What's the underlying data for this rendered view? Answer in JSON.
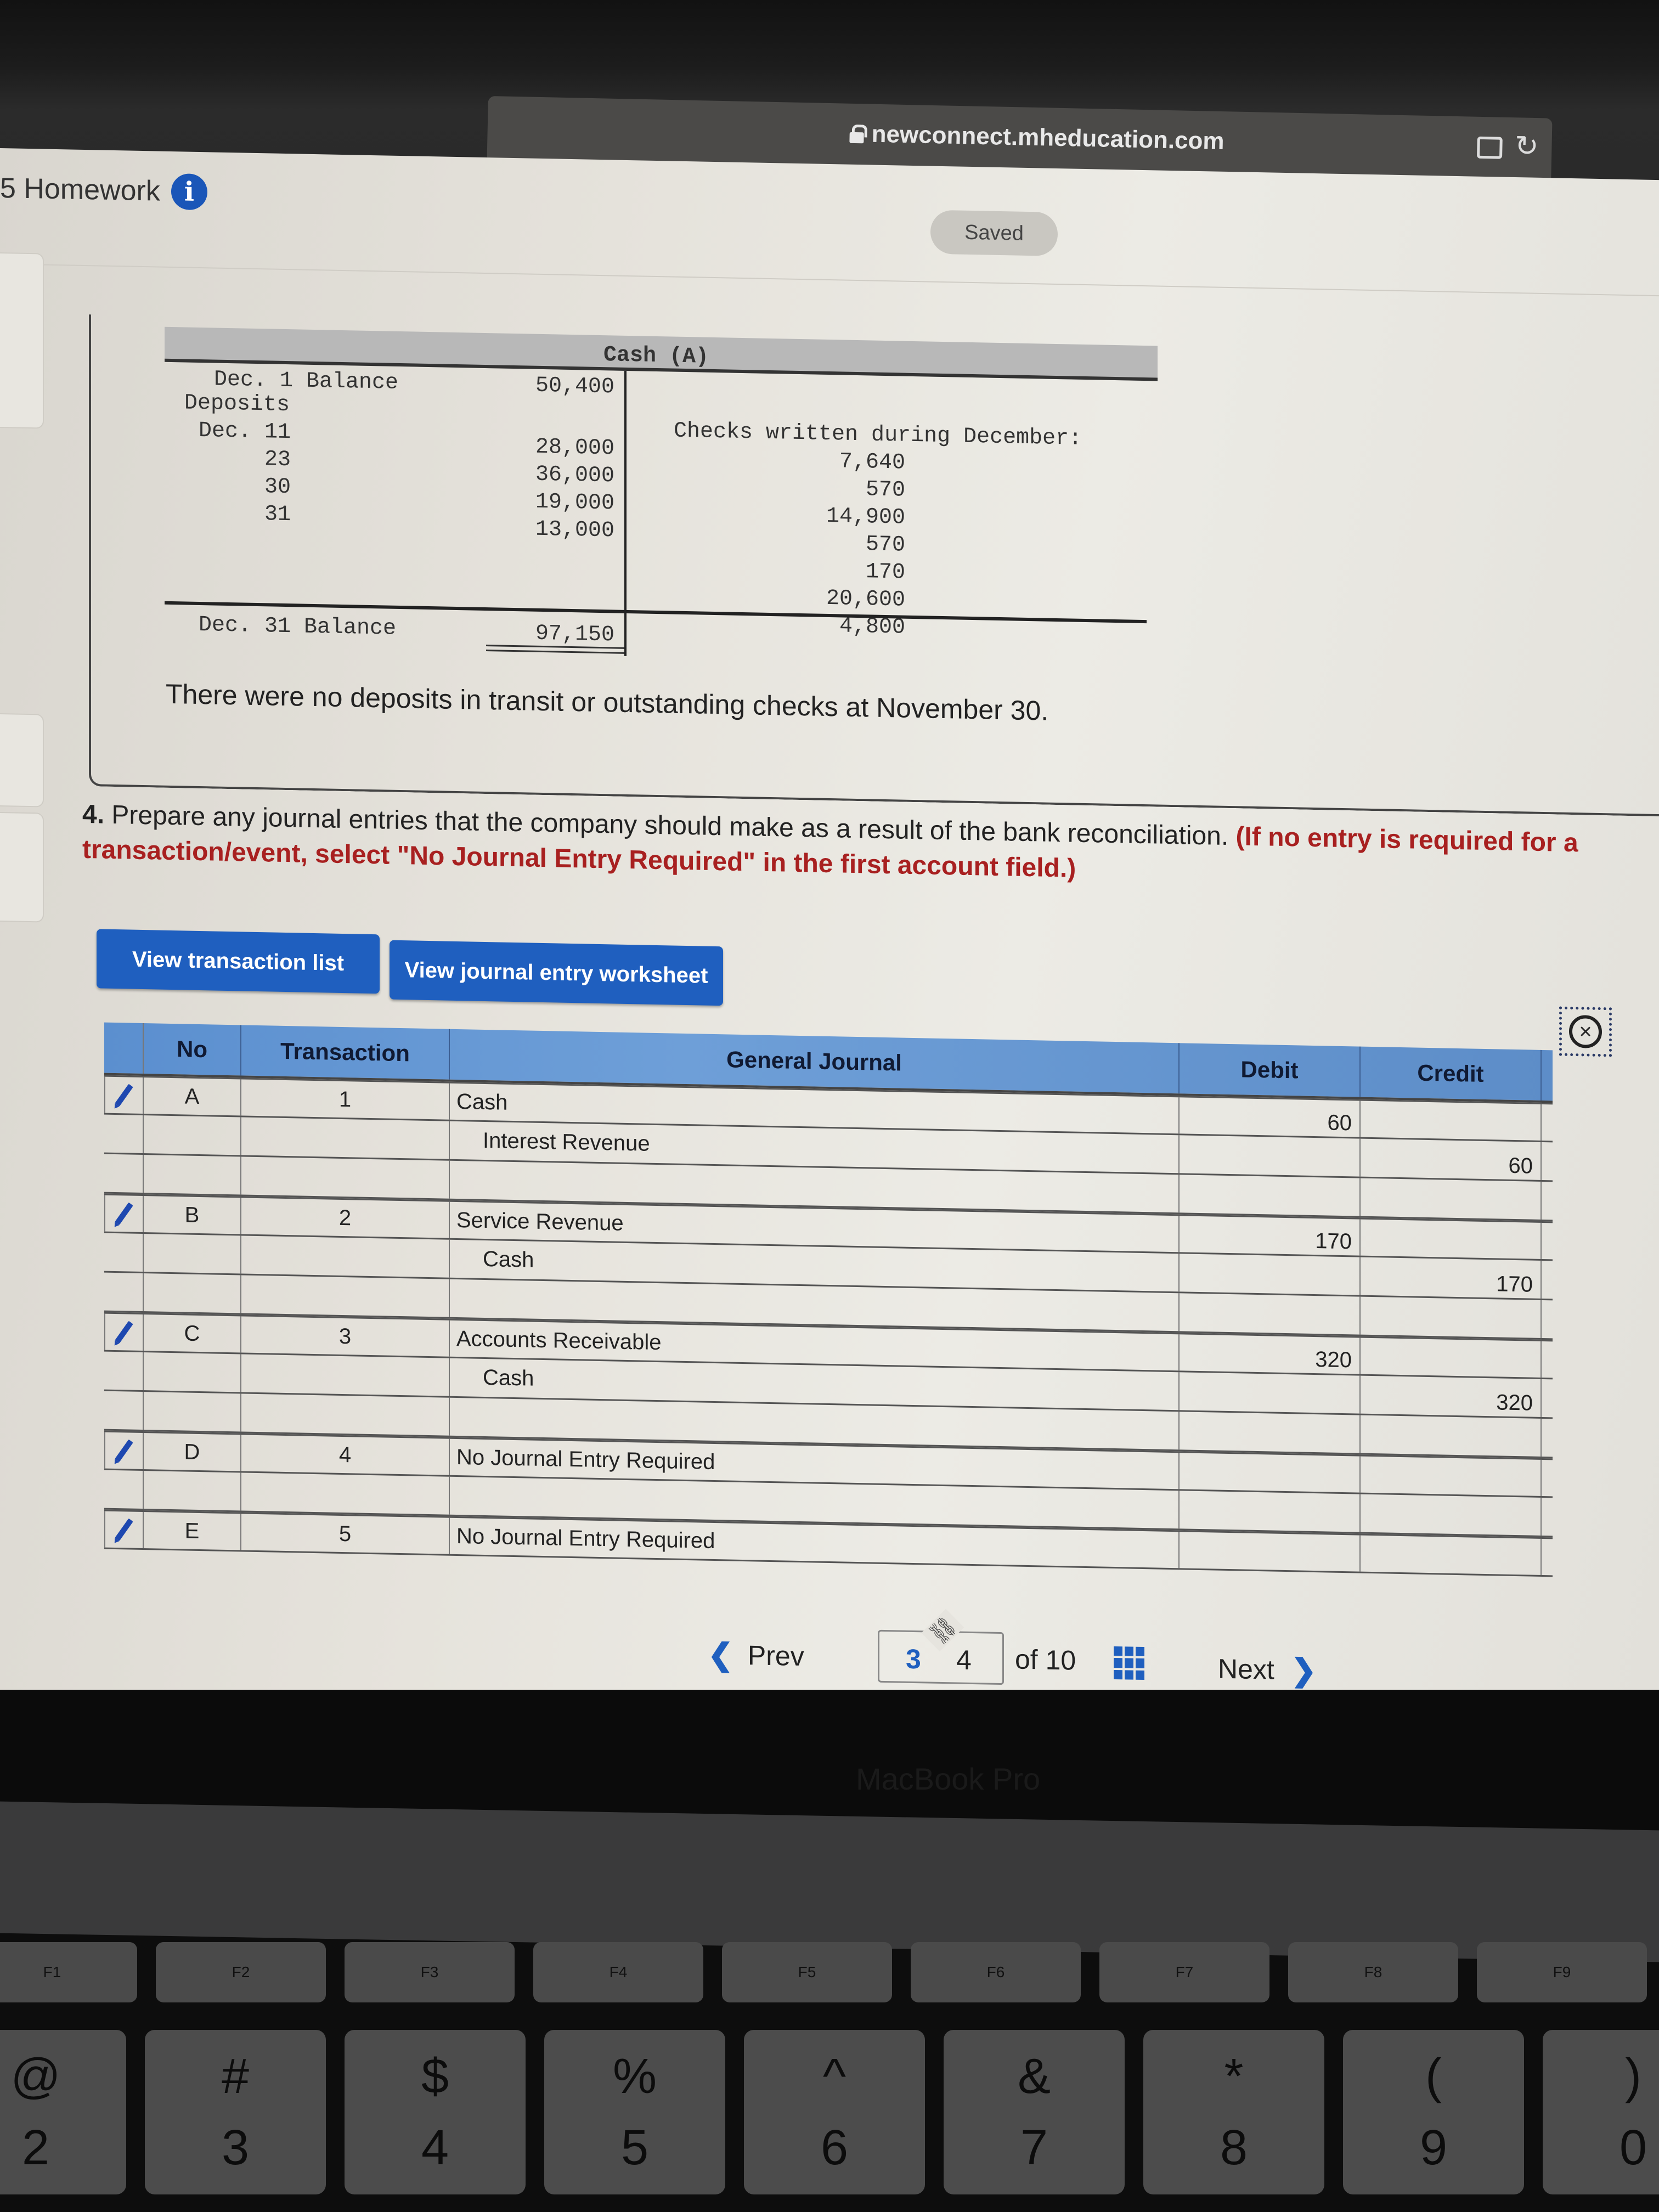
{
  "browser": {
    "url": "newconnect.mheducation.com",
    "tabs_icon": "tabs-icon",
    "reload_icon": "reload-icon"
  },
  "header": {
    "title": "5 Homework",
    "info_icon": "i",
    "status": "Saved"
  },
  "t_account": {
    "title": "Cash (A)",
    "left": [
      {
        "label": "Dec. 1 Balance",
        "amount": "50,400"
      },
      {
        "label": "Deposits",
        "amount": ""
      },
      {
        "label": "Dec. 11",
        "amount": "28,000"
      },
      {
        "label": "     23",
        "amount": "36,000"
      },
      {
        "label": "     30",
        "amount": "19,000"
      },
      {
        "label": "     31",
        "amount": "13,000"
      }
    ],
    "right_title": "Checks written during December:",
    "right": [
      "7,640",
      "570",
      "14,900",
      "570",
      "170",
      "20,600",
      "4,800"
    ],
    "ending_label": "Dec. 31 Balance",
    "ending_amount": "97,150"
  },
  "note": "There were no deposits in transit or outstanding checks at November 30.",
  "question": {
    "number": "4.",
    "text": "Prepare any journal entries that the company should make as a result of the bank reconciliation.",
    "instruction": "(If no entry is required for a transaction/event, select \"No Journal Entry Required\" in the first account field.)"
  },
  "buttons": {
    "view_transactions": "View transaction list",
    "view_worksheet": "View journal entry worksheet"
  },
  "journal": {
    "headers": {
      "no": "No",
      "transaction": "Transaction",
      "account": "General Journal",
      "debit": "Debit",
      "credit": "Credit"
    },
    "entries": [
      {
        "no": "A",
        "transaction": "1",
        "lines": [
          {
            "account": "Cash",
            "debit": "60",
            "credit": "",
            "indent": false
          },
          {
            "account": "Interest Revenue",
            "debit": "",
            "credit": "60",
            "indent": true
          },
          {
            "account": "",
            "debit": "",
            "credit": "",
            "indent": false
          }
        ]
      },
      {
        "no": "B",
        "transaction": "2",
        "lines": [
          {
            "account": "Service Revenue",
            "debit": "170",
            "credit": "",
            "indent": false
          },
          {
            "account": "Cash",
            "debit": "",
            "credit": "170",
            "indent": true
          },
          {
            "account": "",
            "debit": "",
            "credit": "",
            "indent": false
          }
        ]
      },
      {
        "no": "C",
        "transaction": "3",
        "lines": [
          {
            "account": "Accounts Receivable",
            "debit": "320",
            "credit": "",
            "indent": false
          },
          {
            "account": "Cash",
            "debit": "",
            "credit": "320",
            "indent": true
          },
          {
            "account": "",
            "debit": "",
            "credit": "",
            "indent": false
          }
        ]
      },
      {
        "no": "D",
        "transaction": "4",
        "lines": [
          {
            "account": "No Journal Entry Required",
            "debit": "",
            "credit": "",
            "indent": false
          },
          {
            "account": "",
            "debit": "",
            "credit": "",
            "indent": false
          }
        ]
      },
      {
        "no": "E",
        "transaction": "5",
        "lines": [
          {
            "account": "No Journal Entry Required",
            "debit": "",
            "credit": "",
            "indent": false
          }
        ]
      }
    ]
  },
  "pagination": {
    "prev_label": "Prev",
    "current_page": "3",
    "next_page": "4",
    "of_total": "of 10",
    "next_label": "Next"
  },
  "device": {
    "brand": "MacBook Pro",
    "fkeys": [
      "F1",
      "F2",
      "F3",
      "F4",
      "F5",
      "F6",
      "F7",
      "F8",
      "F9"
    ],
    "number_keys": [
      {
        "top": "@",
        "bottom": "2"
      },
      {
        "top": "#",
        "bottom": "3"
      },
      {
        "top": "$",
        "bottom": "4"
      },
      {
        "top": "%",
        "bottom": "5"
      },
      {
        "top": "^",
        "bottom": "6"
      },
      {
        "top": "&",
        "bottom": "7"
      },
      {
        "top": "*",
        "bottom": "8"
      },
      {
        "top": "(",
        "bottom": "9"
      },
      {
        "top": ")",
        "bottom": "0"
      }
    ]
  }
}
